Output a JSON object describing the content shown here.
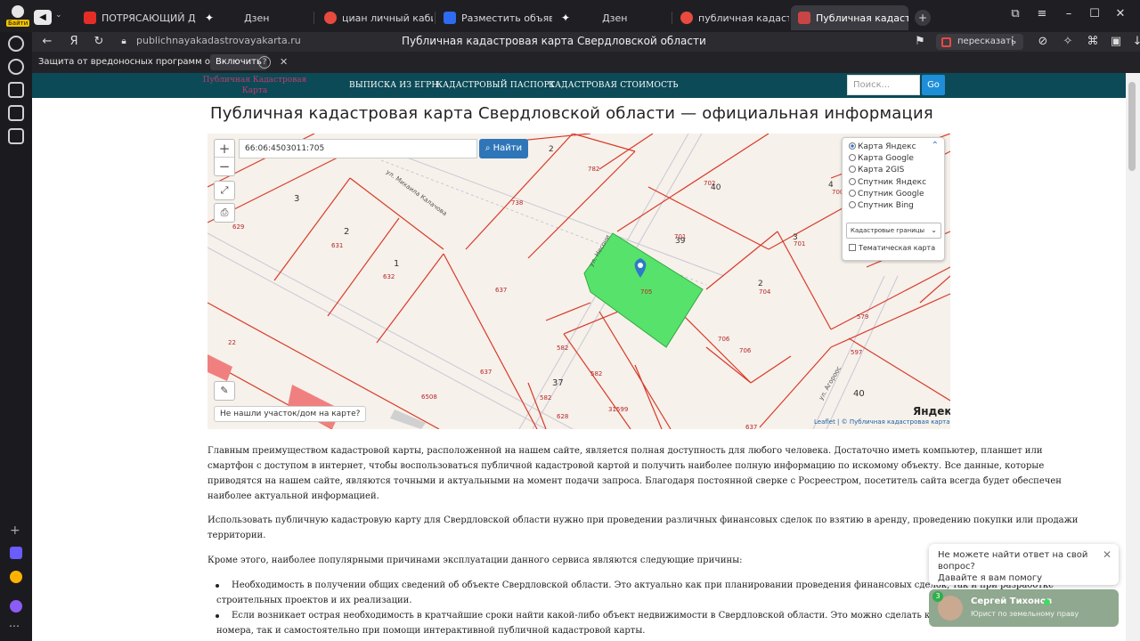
{
  "browser": {
    "left_badge": "Байти",
    "tabs": [
      {
        "label": "ПОТРЯСАЮЩИЙ Д",
        "fav_color": "#e52d27"
      },
      {
        "label": "Дзен",
        "fav_color": ""
      },
      {
        "label": "циан личный кабинет во",
        "fav_color": "#e84a3f"
      },
      {
        "label": "Разместить объявление о",
        "fav_color": "#2f6bf0"
      },
      {
        "label": "Дзен",
        "fav_color": ""
      },
      {
        "label": "публичная кадастровая к",
        "fav_color": "#e84a3f"
      },
      {
        "label": "Публичная кадастровая",
        "fav_color": "#c94545"
      }
    ],
    "url": "publichnayakadastrovayakarta.ru",
    "page_title": "Публичная кадастровая карта Свердловской области",
    "retell_label": "пересказать",
    "security_message": "Защита от вредоносных программ отключена",
    "enable_label": "Включить"
  },
  "site": {
    "logo_line1": "Публичная Кадастровая",
    "logo_line2": "Карта",
    "nav": [
      "ВЫПИСКА ИЗ ЕГРН",
      "КАДАСТРОВЫЙ ПАСПОРТ",
      "КАДАСТРОВАЯ СТОИМОСТЬ"
    ],
    "search_placeholder": "Поиск...",
    "go_label": "Go"
  },
  "heading": "Публичная кадастровая карта Свердловской области — официальная информация",
  "map": {
    "cadastral_number": "66:06:4503011:705",
    "find_label": "Найти",
    "layers": [
      "Карта Яндекс",
      "Карта Google",
      "Карта 2GIS",
      "Спутник Яндекс",
      "Спутник Google",
      "Спутник Bing"
    ],
    "selected_layer": "Карта Яндекс",
    "boundary_select": "Кадастровые границы",
    "thematic_label": "Тематическая карта",
    "not_found_label": "Не нашли участок/дом на карте?",
    "attribution": "Leaflet | © Публичная кадастровая карта, ©",
    "provider_logo": "Яндекс",
    "street_labels": [
      "ул. Михаила Калачова",
      "ул. Несони",
      "ул. Агороос"
    ],
    "parcel_labels": [
      "3",
      "2",
      "1",
      "629",
      "631",
      "632",
      "637",
      "2",
      "782",
      "738",
      "702",
      "40",
      "4",
      "700",
      "701",
      "39",
      "3",
      "701",
      "2",
      "704",
      "706",
      "706",
      "705",
      "582",
      "582",
      "37",
      "582",
      "637",
      "6508",
      "31599",
      "22",
      "579",
      "597",
      "40",
      "637",
      "628"
    ],
    "marker_icon": "map-pin-icon"
  },
  "content": {
    "p1": [
      "Главным преимуществом кадастровой карты, расположенной на нашем сайте, является полная доступность для любого человека. Достаточно иметь компьютер, планшет или",
      "смартфон с доступом в интернет, чтобы воспользоваться публичной кадастровой картой и получить наиболее полную информацию по искомому объекту. Все данные, которые",
      "приводятся на нашем сайте, являются точными и актуальными на момент подачи запроса. Благодаря постоянной сверке с Росреестром, посетитель сайта всегда будет обеспечен",
      "наиболее актуальной информацией."
    ],
    "p2": [
      "Использовать публичную кадастровую карту для Свердловской области нужно при проведении различных финансовых сделок по взятию в аренду, проведению покупки или продажи",
      "территории."
    ],
    "p3": "Кроме этого, наиболее популярными причинами эксплуатации данного сервиса являются следующие причины:",
    "bullets": [
      [
        "Необходимость в получении общих сведений об объекте Свердловской области. Это актуально как при планировании проведения финансовых сделок, так и при разработке",
        "строительных проектов и их реализации."
      ],
      [
        "Если возникает острая необходимость в кратчайшие сроки найти какой-либо объект недвижимости в Свердловской области. Это можно сделать как при наличии кадастрового",
        "номера, так и самостоятельно при помощи интерактивной публичной кадастровой карты."
      ]
    ]
  },
  "chat": {
    "question_line1": "Не можете найти ответ на свой вопрос?",
    "question_line2": "Давайте я вам помогу",
    "badge_count": "3",
    "name": "Сергей Тихонов",
    "role": "Юрист по земельному праву"
  },
  "colors": {
    "nav_bg": "#0c4a57",
    "parcel_line": "#d83a2b",
    "selected_parcel": "#57e36b",
    "find_button": "#2f76b8"
  }
}
